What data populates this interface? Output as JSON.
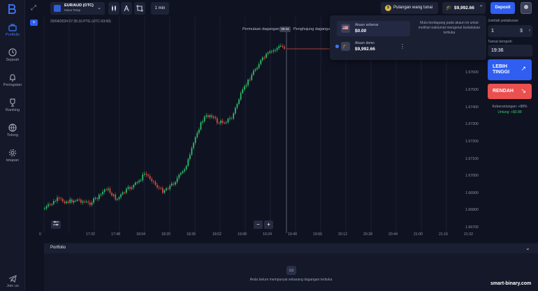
{
  "nav": {
    "items": [
      {
        "label": "Portfolio",
        "icon": "briefcase-icon"
      },
      {
        "label": "Sejarah",
        "icon": "clock-icon"
      },
      {
        "label": "Peringatan",
        "icon": "bell-icon"
      },
      {
        "label": "Ranking",
        "icon": "trophy-icon"
      },
      {
        "label": "Tolong",
        "icon": "globe-icon"
      },
      {
        "label": "tetapan",
        "icon": "gear-icon"
      }
    ],
    "join": "Join us"
  },
  "topbar": {
    "asset_name": "EUR/AUD (OTC)",
    "asset_sub": "Masa Tetap",
    "timeframe": "1 min",
    "cashback": "Pulangan wang tunai",
    "balance": "$9,992.66",
    "deposit": "Deposit"
  },
  "chart": {
    "datetime": "20/04/2024 07:35:16 PTG (UTC-03:00)",
    "trade_start": "Permulaan dagangan",
    "timer": "00:44",
    "trade_end": "Penghujung dagangan",
    "y_ticks": [
      "1.67600",
      "1.67500",
      "1.67400",
      "1.67300",
      "1.67200",
      "1.67100",
      "1.67000",
      "1.66900",
      "1.66800",
      "1.66700"
    ],
    "x_ticks": [
      "0",
      "17:32",
      "17:48",
      "18:04",
      "18:20",
      "18:36",
      "18:52",
      "19:08",
      "19:24",
      "19:40",
      "19:56",
      "20:12",
      "20:28",
      "20:44",
      "21:00",
      "21:16",
      "21:32"
    ]
  },
  "dropdown": {
    "accounts": [
      {
        "name": "Akaun sebenar",
        "value": "$0.00"
      },
      {
        "name": "Akaun demo",
        "value": "$9,992.66"
      }
    ],
    "message": "Mula berdagang pada akaun ini untuk melihat maklumat mengenai kedudukan terbuka"
  },
  "right": {
    "amount_label": "Jumlah pelaburan",
    "amount_value": "1",
    "amount_unit": "$",
    "expiry_label": "Tamat tempoh",
    "expiry_value": "19:36",
    "higher": "LEBIH TINGGI",
    "lower": "RENDAH",
    "profit_label": "Keberuntungan: +88%",
    "profit_value": "Untung: +$0.88"
  },
  "portfolio": {
    "title": "Portfolio",
    "empty": "Anda belum mempunyai sebarang dagangan terbuka"
  },
  "watermark": "smart-binary.com",
  "colors": {
    "up": "#2ec46a",
    "down": "#e24b3b",
    "accent": "#2f5ef0"
  }
}
